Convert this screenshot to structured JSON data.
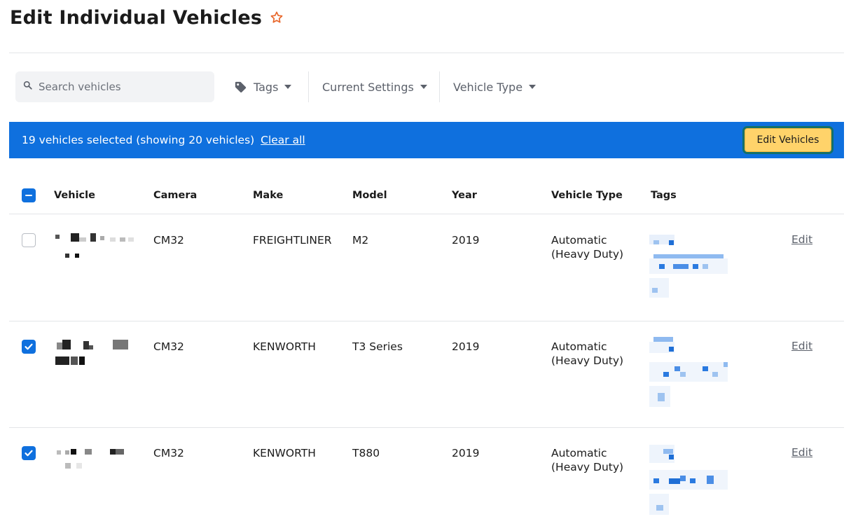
{
  "page": {
    "title": "Edit Individual Vehicles",
    "favorite_icon": "star-icon",
    "accent_color": "#0f70de",
    "favorite_color": "#e8672b"
  },
  "filters": {
    "search_placeholder": "Search vehicles",
    "tags_label": "Tags",
    "current_settings_label": "Current Settings",
    "vehicle_type_label": "Vehicle Type"
  },
  "selection": {
    "summary": "19 vehicles selected (showing 20 vehicles)",
    "clear_label": "Clear all",
    "edit_button_label": "Edit Vehicles",
    "bar_color": "#0f70de",
    "button_color": "#ffd36a"
  },
  "table": {
    "headers": {
      "vehicle": "Vehicle",
      "camera": "Camera",
      "make": "Make",
      "model": "Model",
      "year": "Year",
      "vehicle_type": "Vehicle Type",
      "tags": "Tags"
    },
    "select_all_state": "partial",
    "rows": [
      {
        "checked": false,
        "camera": "CM32",
        "make": "FREIGHTLINER",
        "model": "M2",
        "year": "2019",
        "vehicle_type_line1": "Automatic",
        "vehicle_type_line2": "(Heavy Duty)",
        "edit_label": "Edit"
      },
      {
        "checked": true,
        "camera": "CM32",
        "make": "KENWORTH",
        "model": "T3 Series",
        "year": "2019",
        "vehicle_type_line1": "Automatic",
        "vehicle_type_line2": "(Heavy Duty)",
        "edit_label": "Edit"
      },
      {
        "checked": true,
        "camera": "CM32",
        "make": "KENWORTH",
        "model": "T880",
        "year": "2019",
        "vehicle_type_line1": "Automatic",
        "vehicle_type_line2": "(Heavy Duty)",
        "edit_label": "Edit"
      }
    ]
  }
}
